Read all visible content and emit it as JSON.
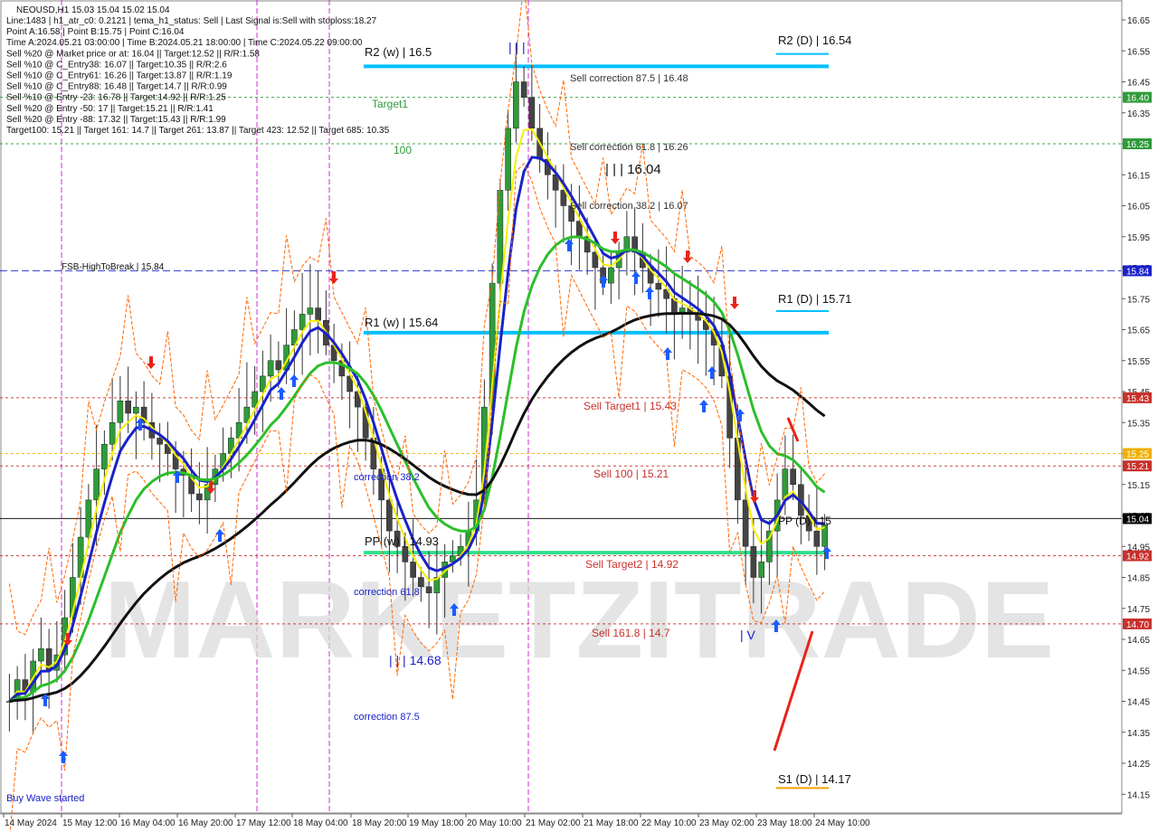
{
  "chart_data": {
    "type": "candlestick",
    "symbol_line": "NEOUSD,H1  15.03 15.04 15.02 15.04",
    "info_lines": [
      "Line:1483  |  h1_atr_c0: 0.2121  |  tema_h1_status: Sell  |  Last Signal is:Sell with stoploss:18.27",
      "Point A:16.58  |  Point B:15.75  |  Point C:16.04",
      "Time A:2024.05.21 03:00:00  |  Time B:2024.05.21 18:00:00  |  Time C:2024.05.22 09:00:00",
      "Sell %20 @ Market price or at: 16.04  ||  Target:12.52  ||  R/R:1.58",
      "Sell %10 @ C_Entry38: 16.07  ||  Target:10.35  ||  R/R:2.6",
      "Sell %10 @ C_Entry61: 16.26  ||  Target:13.87  ||  R/R:1.19",
      "Sell %10 @ C_Entry88: 16.48  ||  Target:14.7  ||  R/R:0.99",
      "Sell %10 @ Entry -23: 16.78  ||  Target:14.92  ||  R/R:1.25",
      "Sell %20 @ Entry -50: 17  ||  Target:15.21  ||  R/R:1.41",
      "Sell %20 @ Entry -88: 17.32  ||  Target:15.43  ||  R/R:1.99",
      "Target100: 15.21  ||  Target 161: 14.7  ||  Target 261: 13.87  ||  Target 423: 12.52  ||  Target 685: 10.35"
    ],
    "ylim": [
      14.1,
      16.7
    ],
    "y_ticks": [
      16.65,
      16.55,
      16.45,
      16.35,
      16.25,
      16.15,
      16.05,
      15.95,
      15.85,
      15.75,
      15.65,
      15.55,
      15.45,
      15.35,
      15.25,
      15.15,
      15.05,
      14.95,
      14.85,
      14.75,
      14.65,
      14.55,
      14.45,
      14.35,
      14.25,
      14.15
    ],
    "x_ticks": [
      "14 May 2024",
      "15 May 12:00",
      "16 May 04:00",
      "16 May 20:00",
      "17 May 12:00",
      "18 May 04:00",
      "18 May 20:00",
      "19 May 18:00",
      "20 May 10:00",
      "21 May 02:00",
      "21 May 18:00",
      "22 May 10:00",
      "23 May 02:00",
      "23 May 18:00",
      "24 May 10:00"
    ],
    "price_tags": [
      {
        "value": 16.4,
        "label": "16.40",
        "color": "#2f9b3a"
      },
      {
        "value": 16.25,
        "label": "16.25",
        "color": "#2f9b3a"
      },
      {
        "value": 15.84,
        "label": "15.84",
        "color": "#1a22c8"
      },
      {
        "value": 15.43,
        "label": "15.43",
        "color": "#c8312c"
      },
      {
        "value": 15.25,
        "label": "15.25",
        "color": "#f0b000"
      },
      {
        "value": 15.21,
        "label": "15.21",
        "color": "#c8312c"
      },
      {
        "value": 15.04,
        "label": "15.04",
        "color": "#000000"
      },
      {
        "value": 14.92,
        "label": "14.92",
        "color": "#c8312c"
      },
      {
        "value": 14.7,
        "label": "14.70",
        "color": "#c8312c"
      }
    ],
    "pivot_levels": [
      {
        "label": "R2 (w) | 16.5",
        "value": 16.5
      },
      {
        "label": "R1 (w) | 15.64",
        "value": 15.64
      },
      {
        "label": "PP (w) | 14.93",
        "value": 14.93
      }
    ],
    "daily_levels": [
      {
        "label": "R2 (D) | 16.54",
        "value": 16.54
      },
      {
        "label": "R1 (D) | 15.71",
        "value": 15.71
      },
      {
        "label": "PP (D) | 15",
        "value": 15.0
      },
      {
        "label": "S1 (D) | 14.17",
        "value": 14.17
      }
    ],
    "annotations": [
      "Target1",
      "100",
      "FSB-HighToBreak | 15.84",
      "Sell correction 87.5 | 16.48",
      "Sell correction 61.8 | 16.26",
      "Sell correction 38.2 | 16.07",
      "| | | 16.04",
      "Sell Target1 | 15.43",
      "Sell 100 | 15.21",
      "Sell Target2 | 14.92",
      "Sell 161.8 | 14.7",
      "correction 38.2",
      "correction 61.8",
      "correction 87.5",
      "| | | 14.68",
      "| | |",
      "| V",
      "Buy Wave started"
    ],
    "close_series": [
      14.45,
      14.52,
      14.48,
      14.58,
      14.62,
      14.55,
      14.6,
      14.72,
      14.85,
      14.98,
      15.1,
      15.2,
      15.28,
      15.35,
      15.42,
      15.38,
      15.4,
      15.35,
      15.3,
      15.28,
      15.25,
      15.2,
      15.18,
      15.12,
      15.1,
      15.15,
      15.2,
      15.25,
      15.3,
      15.35,
      15.4,
      15.45,
      15.5,
      15.55,
      15.52,
      15.6,
      15.65,
      15.7,
      15.72,
      15.68,
      15.6,
      15.55,
      15.5,
      15.45,
      15.4,
      15.3,
      15.2,
      15.1,
      15.0,
      14.95,
      14.9,
      14.85,
      14.82,
      14.8,
      14.85,
      14.9,
      14.92,
      14.95,
      15.0,
      15.1,
      15.4,
      15.8,
      16.1,
      16.3,
      16.45,
      16.4,
      16.3,
      16.2,
      16.15,
      16.1,
      16.05,
      16.0,
      15.95,
      15.9,
      15.85,
      15.8,
      15.85,
      15.9,
      15.95,
      15.9,
      15.85,
      15.8,
      15.78,
      15.75,
      15.7,
      15.72,
      15.7,
      15.68,
      15.65,
      15.6,
      15.5,
      15.3,
      15.1,
      14.95,
      14.85,
      14.9,
      15.0,
      15.1,
      15.2,
      15.15,
      15.05,
      15.0,
      14.95,
      15.02
    ]
  },
  "watermark": "MARKETZITRADE",
  "colors": {
    "resistance": "#00bfff",
    "pivot": "#2fe08a",
    "ema_blue": "#1a22c8",
    "ema_green": "#2bbf2b",
    "yellow": "#f5f000",
    "black_ma": "#111111",
    "red": "#e8231a",
    "orange": "#ff6600"
  }
}
